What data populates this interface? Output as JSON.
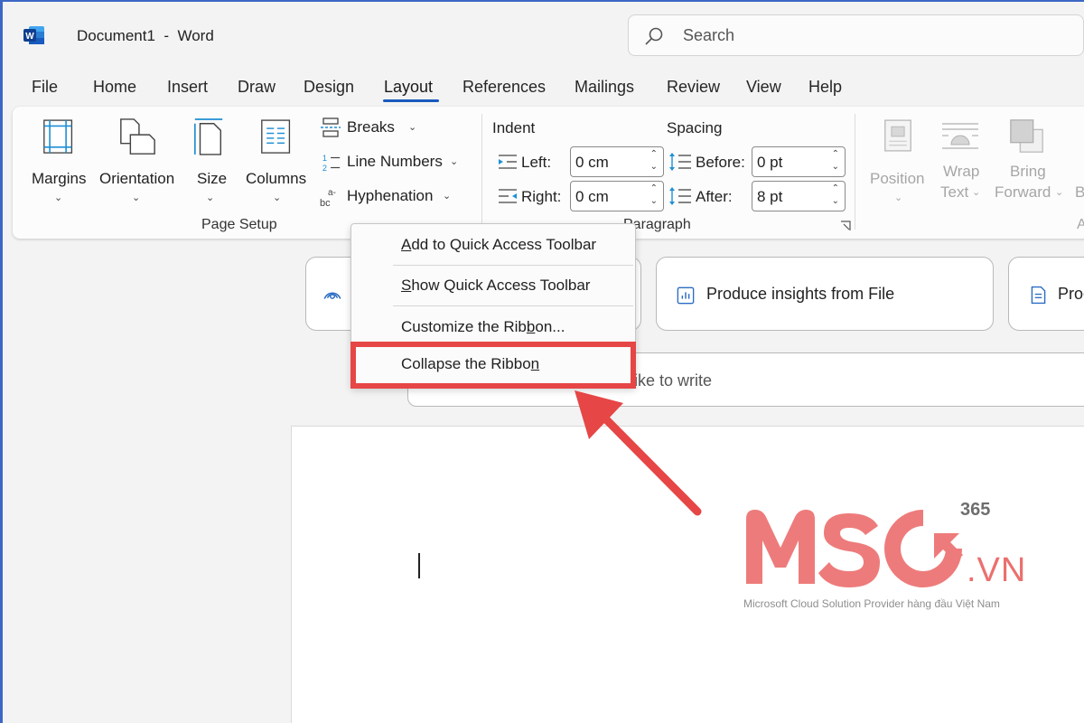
{
  "window": {
    "title": "Document1  -  Word",
    "search_placeholder": "Search"
  },
  "tabs": [
    "File",
    "Home",
    "Insert",
    "Draw",
    "Design",
    "Layout",
    "References",
    "Mailings",
    "Review",
    "View",
    "Help"
  ],
  "active_tab": "Layout",
  "ribbon": {
    "page_setup": {
      "margins": "Margins",
      "orientation": "Orientation",
      "size": "Size",
      "columns": "Columns",
      "breaks": "Breaks",
      "line_numbers": "Line Numbers",
      "hyphenation": "Hyphenation",
      "label": "Page Setup"
    },
    "paragraph": {
      "indent_label": "Indent",
      "spacing_label": "Spacing",
      "left_label": "Left:",
      "left_value": "0 cm",
      "right_label": "Right:",
      "right_value": "0 cm",
      "before_label": "Before:",
      "before_value": "0 pt",
      "after_label": "After:",
      "after_value": "8 pt",
      "label": "Paragraph"
    },
    "arrange": {
      "position": "Position",
      "wrap_text_1": "Wrap",
      "wrap_text_2": "Text",
      "bring_forward_1": "Bring",
      "bring_forward_2": "Forward",
      "cut_letter": "B",
      "cut_group_letter": "A"
    }
  },
  "copilot": {
    "card2": "Produce insights from File",
    "card3": "Proc",
    "prompt": "ike to write"
  },
  "context_menu": {
    "items": [
      "Add to Quick Access Toolbar",
      "Show Quick Access Toolbar",
      "Customize the Ribbon...",
      "Collapse the Ribbon"
    ],
    "highlighted_index": 3
  },
  "watermark": {
    "brand": "MSO",
    "sup": "365",
    "domain": ".VN",
    "tagline": "Microsoft Cloud Solution Provider hàng đầu Việt Nam"
  },
  "colors": {
    "accent": "#185abd",
    "highlight": "#e64646",
    "watermark": "#ec6f6f"
  }
}
